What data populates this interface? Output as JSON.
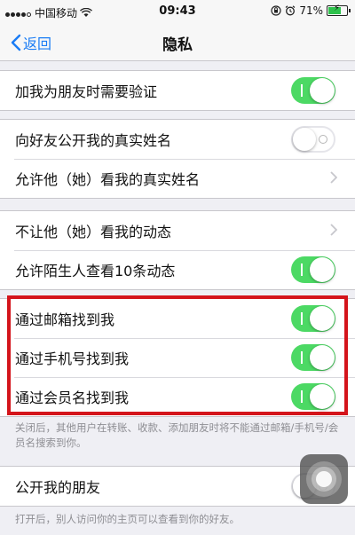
{
  "status_bar": {
    "carrier": "中国移动",
    "time": "09:43",
    "battery_percent": "71%",
    "battery_level": 0.71,
    "icons": [
      "signal-dots-icon",
      "wifi-icon",
      "lock-rotation-icon",
      "alarm-icon",
      "battery-icon"
    ]
  },
  "nav": {
    "back_label": "返回",
    "title": "隐私"
  },
  "groups": [
    {
      "rows": [
        {
          "label": "加我为朋友时需要验证",
          "control": "toggle",
          "on": true
        }
      ]
    },
    {
      "rows": [
        {
          "label": "向好友公开我的真实姓名",
          "control": "toggle",
          "on": false
        },
        {
          "label": "允许他（她）看我的真实姓名",
          "control": "chevron"
        }
      ]
    },
    {
      "rows": [
        {
          "label": "不让他（她）看我的动态",
          "control": "chevron"
        },
        {
          "label": "允许陌生人查看10条动态",
          "control": "toggle",
          "on": true
        }
      ]
    },
    {
      "rows": [
        {
          "label": "通过邮箱找到我",
          "control": "toggle",
          "on": true
        },
        {
          "label": "通过手机号找到我",
          "control": "toggle",
          "on": true
        },
        {
          "label": "通过会员名找到我",
          "control": "toggle",
          "on": true
        }
      ],
      "footer": "关闭后，其他用户在转账、收款、添加朋友时将不能通过邮箱/手机号/会员名搜索到你。"
    },
    {
      "rows": [
        {
          "label": "公开我的朋友",
          "control": "toggle",
          "on": false
        }
      ],
      "footer": "打开后，别人访问你的主页可以查看到你的好友。"
    }
  ],
  "colors": {
    "accent_blue": "#1a7cf5",
    "toggle_on": "#4cd964",
    "highlight_red": "#d4141b",
    "background": "#efeff4"
  }
}
